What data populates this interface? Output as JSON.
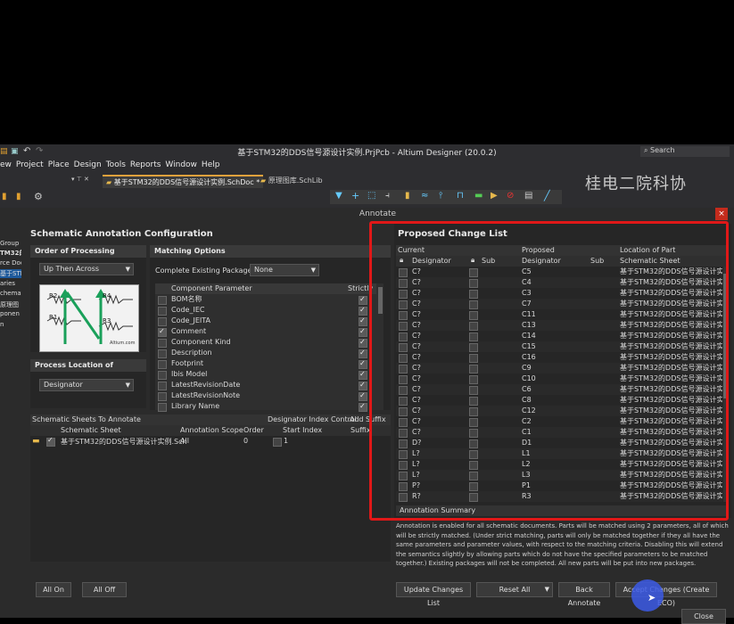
{
  "app": {
    "title": "基于STM32的DDS信号源设计实例.PrjPcb - Altium Designer (20.0.2)",
    "search_placeholder": "Search",
    "menu": [
      "ew",
      "Project",
      "Place",
      "Design",
      "Tools",
      "Reports",
      "Window",
      "Help"
    ],
    "tabs": [
      {
        "label": "基于STM32的DDS信号源设计实例.SchDoc *"
      },
      {
        "label": "原理图库.SchLib"
      }
    ],
    "panel_pin_controls": "▾ ⊤ ✕",
    "watermark": "桂电二院科协"
  },
  "sidebar": {
    "items": [
      "Group",
      "TM32的",
      "rce Doc",
      "基于STM",
      "aries",
      "chemat",
      "原理图",
      "ponen",
      "n"
    ]
  },
  "dialog": {
    "title": "Annotate",
    "close": "×",
    "config_title": "Schematic Annotation Configuration",
    "order": {
      "title": "Order of Processing",
      "value": "Up Then Across",
      "diagram_labels": [
        "R2",
        "R4",
        "R1",
        "R3"
      ],
      "diagram_caption": "Altium.com"
    },
    "process_location": {
      "title": "Process Location of",
      "value": "Designator"
    },
    "matching": {
      "title": "Matching Options",
      "complete_label": "Complete Existing Packages",
      "complete_value": "None",
      "col_param": "Component Parameter",
      "col_strictly": "Strictly",
      "params": [
        {
          "name": "BOM名称",
          "checked": false,
          "strict": true
        },
        {
          "name": "Code_IEC",
          "checked": false,
          "strict": true
        },
        {
          "name": "Code_JEITA",
          "checked": false,
          "strict": true
        },
        {
          "name": "Comment",
          "checked": true,
          "strict": true
        },
        {
          "name": "Component Kind",
          "checked": false,
          "strict": true
        },
        {
          "name": "Description",
          "checked": false,
          "strict": true
        },
        {
          "name": "Footprint",
          "checked": false,
          "strict": true
        },
        {
          "name": "Ibis Model",
          "checked": false,
          "strict": true
        },
        {
          "name": "LatestRevisionDate",
          "checked": false,
          "strict": true
        },
        {
          "name": "LatestRevisionNote",
          "checked": false,
          "strict": true
        },
        {
          "name": "Library Name",
          "checked": false,
          "strict": true
        }
      ]
    },
    "sheets": {
      "title": "Schematic Sheets To Annotate",
      "index_control": "Designator Index Control",
      "add_suffix": "Add Suffix",
      "cols": [
        "Schematic Sheet",
        "Annotation Scope",
        "Order",
        "Start Index",
        "Suffix"
      ],
      "rows": [
        {
          "sheet": "基于STM32的DDS信号源设计实例.Sch",
          "scope": "All",
          "order": "0",
          "start": "1",
          "suffix": ""
        }
      ]
    },
    "proposed": {
      "title": "Proposed Change List",
      "group_current": "Current",
      "group_proposed": "Proposed",
      "group_location": "Location of Part",
      "col_designator": "Designator",
      "col_sub": "Sub",
      "col_pdesignator": "Designator",
      "col_psub": "Sub",
      "col_sheet": "Schematic Sheet",
      "rows": [
        {
          "cur": "C?",
          "prop": "C5",
          "sheet": "基于STM32的DDS信号源设计实例"
        },
        {
          "cur": "C?",
          "prop": "C4",
          "sheet": "基于STM32的DDS信号源设计实例"
        },
        {
          "cur": "C?",
          "prop": "C3",
          "sheet": "基于STM32的DDS信号源设计实例"
        },
        {
          "cur": "C?",
          "prop": "C7",
          "sheet": "基于STM32的DDS信号源设计实例"
        },
        {
          "cur": "C?",
          "prop": "C11",
          "sheet": "基于STM32的DDS信号源设计实例"
        },
        {
          "cur": "C?",
          "prop": "C13",
          "sheet": "基于STM32的DDS信号源设计实例"
        },
        {
          "cur": "C?",
          "prop": "C14",
          "sheet": "基于STM32的DDS信号源设计实例"
        },
        {
          "cur": "C?",
          "prop": "C15",
          "sheet": "基于STM32的DDS信号源设计实例"
        },
        {
          "cur": "C?",
          "prop": "C16",
          "sheet": "基于STM32的DDS信号源设计实例"
        },
        {
          "cur": "C?",
          "prop": "C9",
          "sheet": "基于STM32的DDS信号源设计实例"
        },
        {
          "cur": "C?",
          "prop": "C10",
          "sheet": "基于STM32的DDS信号源设计实例"
        },
        {
          "cur": "C?",
          "prop": "C6",
          "sheet": "基于STM32的DDS信号源设计实例"
        },
        {
          "cur": "C?",
          "prop": "C8",
          "sheet": "基于STM32的DDS信号源设计实例"
        },
        {
          "cur": "C?",
          "prop": "C12",
          "sheet": "基于STM32的DDS信号源设计实例"
        },
        {
          "cur": "C?",
          "prop": "C2",
          "sheet": "基于STM32的DDS信号源设计实例"
        },
        {
          "cur": "C?",
          "prop": "C1",
          "sheet": "基于STM32的DDS信号源设计实例"
        },
        {
          "cur": "D?",
          "prop": "D1",
          "sheet": "基于STM32的DDS信号源设计实例"
        },
        {
          "cur": "L?",
          "prop": "L1",
          "sheet": "基于STM32的DDS信号源设计实例"
        },
        {
          "cur": "L?",
          "prop": "L2",
          "sheet": "基于STM32的DDS信号源设计实例"
        },
        {
          "cur": "L?",
          "prop": "L3",
          "sheet": "基于STM32的DDS信号源设计实例"
        },
        {
          "cur": "P?",
          "prop": "P1",
          "sheet": "基于STM32的DDS信号源设计实例"
        },
        {
          "cur": "R?",
          "prop": "R3",
          "sheet": "基于STM32的DDS信号源设计实例"
        }
      ]
    },
    "summary": {
      "title": "Annotation Summary",
      "text": "Annotation is enabled for all schematic documents. Parts will be matched using 2 parameters, all of which will be strictly matched. (Under strict matching, parts will only be matched together if they all have the same parameters and parameter values, with respect to the matching criteria. Disabling this will extend the semantics slightly by allowing parts which do not have the specified parameters to be matched together.) Existing packages will not be completed. All new parts will be put into new packages."
    },
    "buttons": {
      "all_on": "All On",
      "all_off": "All Off",
      "update": "Update Changes List",
      "reset": "Reset All",
      "back": "Back Annotate",
      "accept": "Accept Changes (Create ECO)",
      "close": "Close"
    }
  }
}
